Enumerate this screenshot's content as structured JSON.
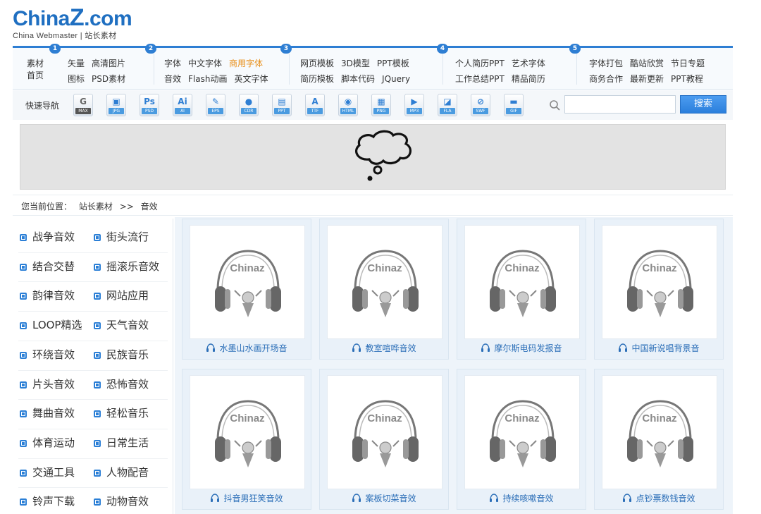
{
  "logo": {
    "main_a": "China",
    "main_z": "Z",
    "main_b": ".com",
    "sub": "China Webmaster  |  站长素材"
  },
  "nav": {
    "badges": [
      "1",
      "2",
      "3",
      "4",
      "5"
    ],
    "home": [
      "素材",
      "首页"
    ],
    "groups": [
      {
        "rows": [
          [
            "矢量",
            "高清图片"
          ],
          [
            "图标",
            "PSD素材"
          ]
        ]
      },
      {
        "rows": [
          [
            "字体",
            "中文字体",
            "商用字体"
          ],
          [
            "音效",
            "Flash动画",
            "英文字体"
          ]
        ],
        "highlight": "商用字体"
      },
      {
        "rows": [
          [
            "网页模板",
            "3D模型",
            "PPT模板"
          ],
          [
            "简历模板",
            "脚本代码",
            "JQuery"
          ]
        ]
      },
      {
        "rows": [
          [
            "个人简历PPT",
            "艺术字体"
          ],
          [
            "工作总结PPT",
            "精品简历"
          ]
        ]
      },
      {
        "rows": [
          [
            "字体打包",
            "酷站欣赏",
            "节日专题"
          ],
          [
            "商务合作",
            "最新更新",
            "PPT教程"
          ]
        ]
      }
    ]
  },
  "quick_nav": {
    "label": "快速导航",
    "items": [
      {
        "sym": "G",
        "label": "MAX"
      },
      {
        "sym": "▣",
        "label": "JPG"
      },
      {
        "sym": "Ps",
        "label": "PSD"
      },
      {
        "sym": "Ai",
        "label": "AI"
      },
      {
        "sym": "✎",
        "label": "EPS"
      },
      {
        "sym": "●",
        "label": "CDR"
      },
      {
        "sym": "▤",
        "label": "PPT"
      },
      {
        "sym": "A",
        "label": "TTF"
      },
      {
        "sym": "◉",
        "label": "HTML"
      },
      {
        "sym": "▦",
        "label": "PNG"
      },
      {
        "sym": "▶",
        "label": "MP3"
      },
      {
        "sym": "◪",
        "label": "FLA"
      },
      {
        "sym": "⊘",
        "label": "SWF"
      },
      {
        "sym": "▬",
        "label": "GIF"
      }
    ],
    "search_placeholder": "",
    "search_button": "搜索"
  },
  "breadcrumb": {
    "prefix": "您当前位置：",
    "home": "站长素材",
    "sep": ">>",
    "current": "音效"
  },
  "categories": [
    [
      "战争音效",
      "街头流行"
    ],
    [
      "结合交替",
      "摇滚乐音效"
    ],
    [
      "韵律音效",
      "网站应用"
    ],
    [
      "LOOP精选",
      "天气音效"
    ],
    [
      "环绕音效",
      "民族音乐"
    ],
    [
      "片头音效",
      "恐怖音效"
    ],
    [
      "舞曲音效",
      "轻松音乐"
    ],
    [
      "体育运动",
      "日常生活"
    ],
    [
      "交通工具",
      "人物配音"
    ],
    [
      "铃声下载",
      "动物音效"
    ]
  ],
  "thumb_logo": "Chinaz",
  "cards": [
    "水墨山水画开场音",
    "教室喧哗音效",
    "摩尔斯电码发报音",
    "中国新说唱背景音",
    "抖音男狂笑音效",
    "案板切菜音效",
    "持续咳嗽音效",
    "点钞票数钱音效"
  ],
  "colors": {
    "accent": "#2e7ed3",
    "highlight": "#e88e18",
    "banner": "#e3e3e3"
  }
}
